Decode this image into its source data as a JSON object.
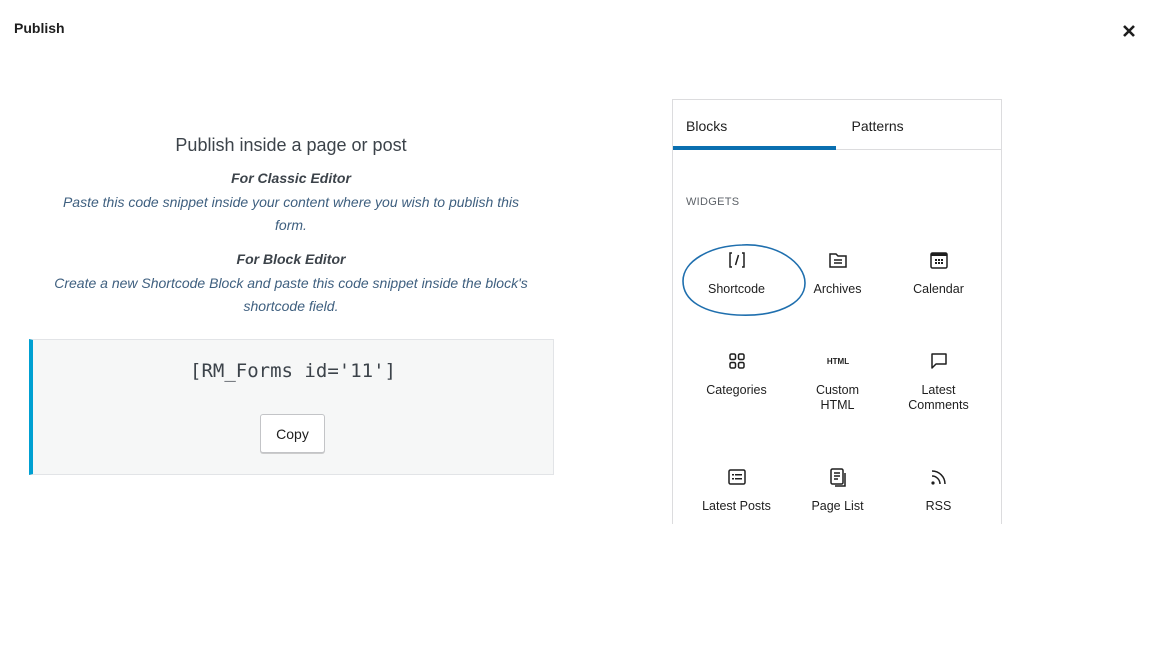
{
  "header": {
    "title": "Publish",
    "close_icon": "close-icon"
  },
  "left": {
    "heading": "Publish inside a page or post",
    "classic": {
      "title": "For Classic Editor",
      "description": "Paste this code snippet inside your content where you wish to publish this form."
    },
    "block": {
      "title": "For Block Editor",
      "description": "Create a new Shortcode Block and paste this code snippet inside the block's shortcode field."
    },
    "shortcode": "[RM_Forms id='11']",
    "copy_label": "Copy",
    "accent_color": "#00a0d2"
  },
  "inserter": {
    "tabs": [
      {
        "label": "Blocks",
        "active": true
      },
      {
        "label": "Patterns",
        "active": false
      }
    ],
    "section_label": "WIDGETS",
    "items": [
      {
        "label": "Shortcode",
        "icon": "shortcode-icon",
        "highlighted": true
      },
      {
        "label": "Archives",
        "icon": "archive-icon"
      },
      {
        "label": "Calendar",
        "icon": "calendar-icon"
      },
      {
        "label": "Categories",
        "icon": "categories-icon"
      },
      {
        "label": "Custom HTML",
        "icon": "html-icon"
      },
      {
        "label": "Latest Comments",
        "icon": "comment-icon"
      },
      {
        "label": "Latest Posts",
        "icon": "post-list-icon"
      },
      {
        "label": "Page List",
        "icon": "page-list-icon"
      },
      {
        "label": "RSS",
        "icon": "rss-icon"
      }
    ],
    "accent_color": "#0a6fb0"
  }
}
